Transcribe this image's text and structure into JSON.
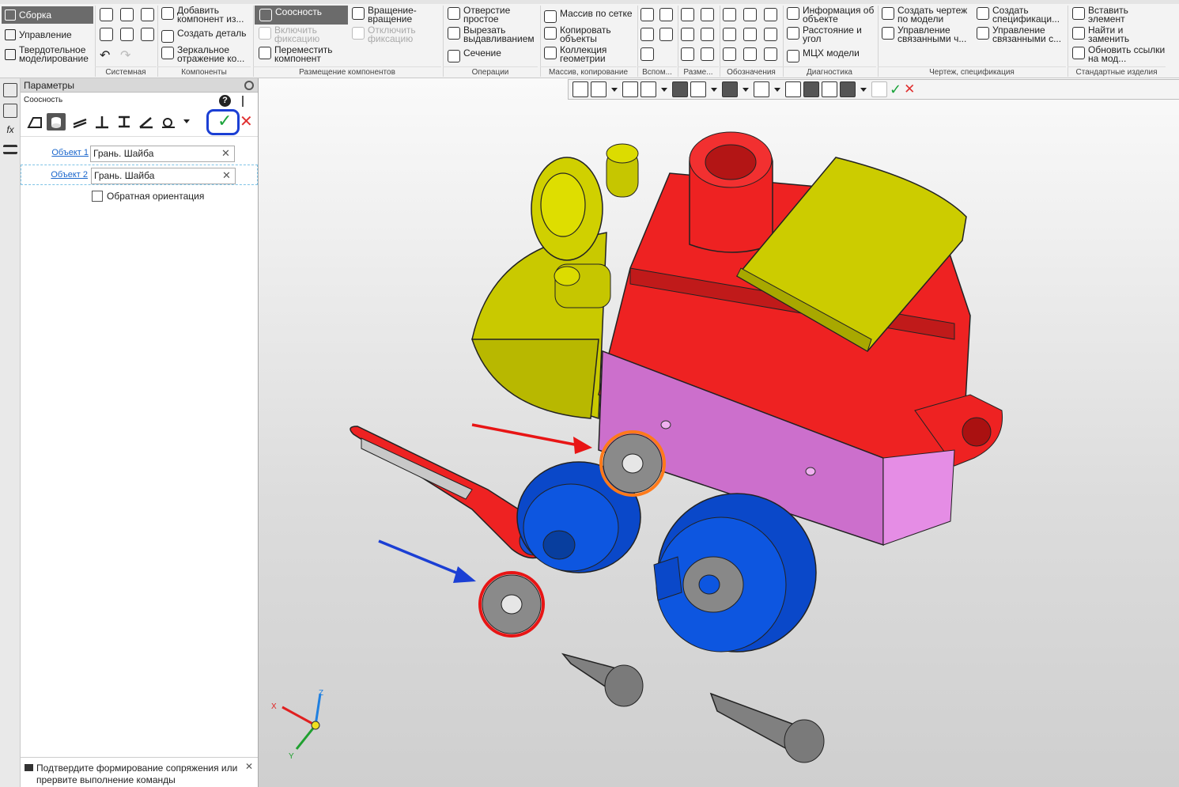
{
  "ribbon": {
    "modes": {
      "assembly": "Сборка",
      "management": "Управление",
      "solid": "Твердотельное моделирование"
    },
    "items": {
      "add_component": "Добавить компонент из...",
      "create_part": "Создать деталь",
      "mirror": "Зеркальное отражение ко...",
      "coaxial": "Соосность",
      "enable_fix": "Включить фиксацию",
      "move_component": "Переместить компонент",
      "rotation": "Вращение-вращение",
      "disable_fix": "Отключить фиксацию",
      "hole_simple": "Отверстие простое",
      "cut_extrude": "Вырезать выдавливанием",
      "section": "Сечение",
      "pattern_grid": "Массив по сетке",
      "copy_objects": "Копировать объекты",
      "geometry_collection": "Коллекция геометрии",
      "object_info": "Информация об объекте",
      "distance_angle": "Расстояние и угол",
      "mass_props": "МЦХ модели",
      "create_drawing": "Создать чертеж по модели",
      "manage_linked_1": "Управление связанными ч...",
      "create_spec": "Создать спецификаци...",
      "manage_linked_2": "Управление связанными с...",
      "insert_element": "Вставить элемент",
      "find_replace": "Найти и заменить",
      "update_links": "Обновить ссылки на мод..."
    },
    "groups": {
      "system": "Системная",
      "components": "Компоненты",
      "placement": "Размещение компонентов",
      "operations": "Операции",
      "pattern_copy": "Массив, копирование",
      "aux": "Вспом...",
      "dims": "Разме...",
      "designations": "Обозначения",
      "diagnostics": "Диагностика",
      "drawing_spec": "Чертеж, спецификация",
      "standard": "Стандартные изделия"
    }
  },
  "panel": {
    "title": "Параметры",
    "subtitle": "Соосность",
    "help": "?",
    "object1_label": "Объект 1",
    "object1_value": "Грань. Шайба",
    "object2_label": "Объект 2",
    "object2_value": "Грань. Шайба",
    "reverse_label": "Обратная ориентация",
    "reverse_checked": false,
    "status_message": "Подтвердите формирование сопряжения или прервите выполнение команды"
  },
  "triad": {
    "x": "X",
    "y": "Y",
    "z": "Z"
  },
  "colors": {
    "accent_active": "#6b6b6b",
    "highlight_box": "#1b3fd4",
    "ok": "#1aa33a",
    "cancel": "#e03030",
    "part_red": "#f01f1f",
    "part_yellow": "#cccc00",
    "part_blue": "#0a4fd1",
    "part_pink": "#d678d6",
    "part_gray": "#8a8a8a"
  }
}
